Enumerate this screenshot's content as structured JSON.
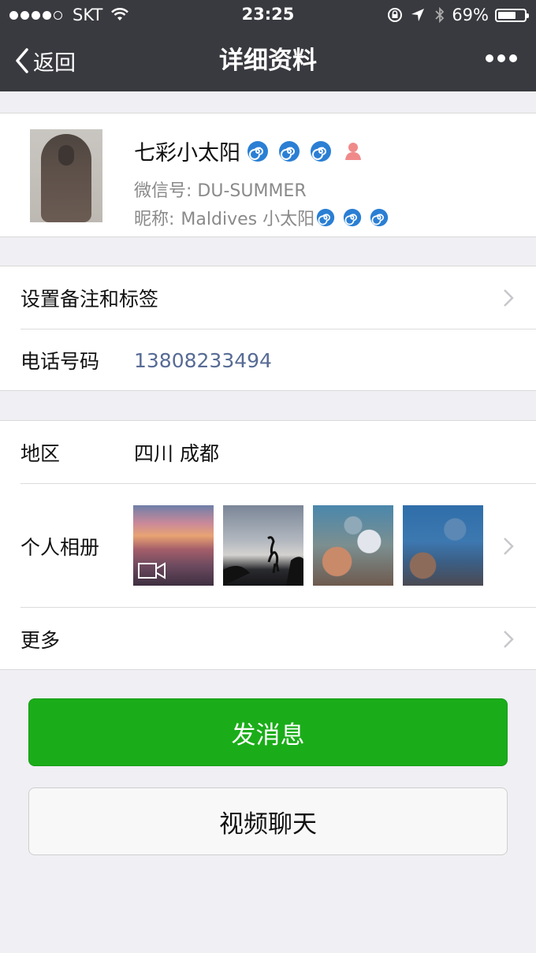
{
  "status_bar": {
    "carrier": "SKT",
    "time": "23:25",
    "battery": "69%",
    "battery_level": 0.69,
    "signal_bars_filled": 4,
    "signal_bars_total": 5
  },
  "nav": {
    "back_label": "返回",
    "title": "详细资料"
  },
  "profile": {
    "name": "七彩小太阳",
    "wechat_id_label": "微信号:",
    "wechat_id": "DU-SUMMER",
    "nickname_label": "昵称:",
    "nickname": "Maldives 小太阳"
  },
  "contact_section": {
    "remark_label": "设置备注和标签",
    "phone_label": "电话号码",
    "phone_value": "13808233494"
  },
  "info_section": {
    "region_label": "地区",
    "region_value": "四川 成都",
    "album_label": "个人相册",
    "more_label": "更多"
  },
  "actions": {
    "message_button": "发消息",
    "video_button": "视频聊天"
  },
  "colors": {
    "nav_bg": "#393a3f",
    "page_bg": "#efeff4",
    "primary_green": "#1aad19",
    "phone_link": "#576b95",
    "spiral_blue": "#2a7fd4",
    "female_icon": "#f08a8a"
  },
  "icons": [
    "chevron-left-icon",
    "more-dots-icon",
    "wifi-icon",
    "lock-rotation-icon",
    "location-arrow-icon",
    "bluetooth-icon",
    "battery-icon",
    "spiral-emoji-icon",
    "female-icon",
    "chevron-right-icon",
    "video-icon"
  ]
}
